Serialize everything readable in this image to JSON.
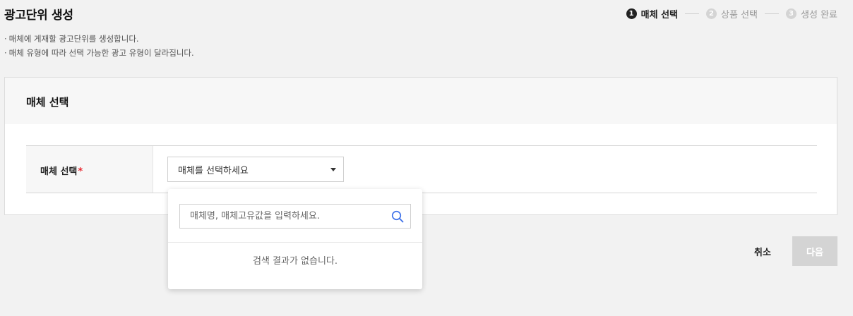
{
  "page": {
    "title": "광고단위 생성",
    "descriptions": [
      "매체에 게재할 광고단위를 생성합니다.",
      "매체 유형에 따라 선택 가능한 광고 유형이 달라집니다."
    ]
  },
  "stepper": {
    "steps": [
      {
        "number": "1",
        "label": "매체 선택",
        "active": true
      },
      {
        "number": "2",
        "label": "상품 선택",
        "active": false
      },
      {
        "number": "3",
        "label": "생성 완료",
        "active": false
      }
    ]
  },
  "card": {
    "title": "매체 선택",
    "field_label": "매체 선택",
    "required_mark": "*",
    "select_value": "매체를 선택하세요",
    "caret_icon": "caret-down-icon"
  },
  "dropdown": {
    "search_placeholder": "매체명, 매체고유값을 입력하세요.",
    "search_icon": "search-icon",
    "empty_message": "검색 결과가 없습니다."
  },
  "buttons": {
    "cancel": "취소",
    "next": "다음"
  },
  "colors": {
    "required": "#e8262e",
    "search_icon": "#3a6ee8",
    "disabled_button": "#d4d4d4"
  }
}
